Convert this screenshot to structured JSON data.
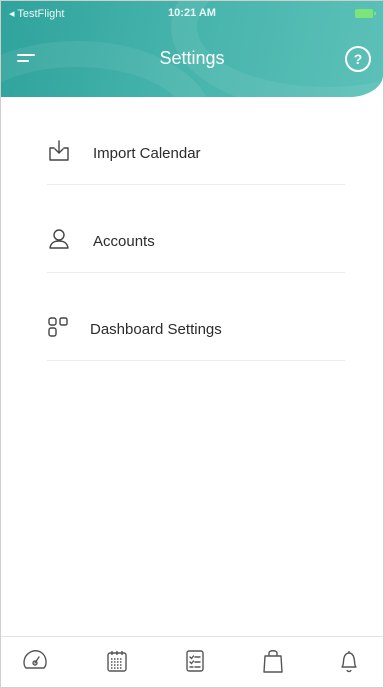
{
  "status_bar": {
    "carrier": "◂ TestFlight",
    "time": "10:21 AM",
    "battery_icon": "battery-charging-icon"
  },
  "header": {
    "title": "Settings",
    "menu_icon": "menu-icon",
    "help_label": "?"
  },
  "settings_items": [
    {
      "label": "Import Calendar",
      "icon": "import-calendar-icon"
    },
    {
      "label": "Accounts",
      "icon": "accounts-icon"
    },
    {
      "label": "Dashboard Settings",
      "icon": "dashboard-icon"
    }
  ],
  "tab_bar": [
    {
      "icon": "speedometer-icon"
    },
    {
      "icon": "calendar-icon"
    },
    {
      "icon": "checklist-icon"
    },
    {
      "icon": "shopping-bag-icon"
    },
    {
      "icon": "bell-icon"
    }
  ],
  "colors": {
    "header": "#45b3ab",
    "text": "#2b2b2b",
    "icon": "#444444"
  }
}
